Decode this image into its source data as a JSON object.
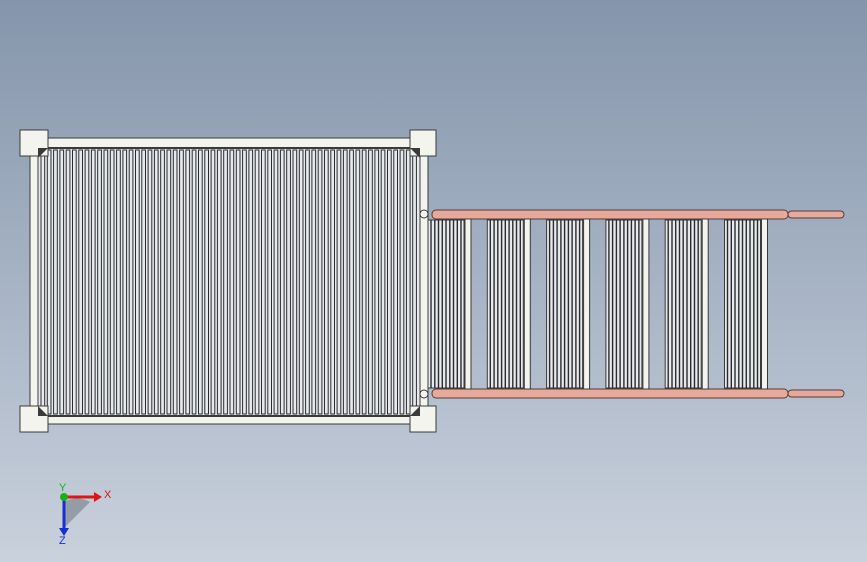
{
  "viewport": {
    "background_top": "#8595ab",
    "background_bottom": "#c9d1dc"
  },
  "model": {
    "frame_color": "#f4f4ef",
    "frame_outline": "#3a3a3a",
    "fin_color": "#2b2b2b",
    "fin_gap_color": "#e6e9ee",
    "pipe_color": "#e6a99c",
    "pipe_outline": "#5a3a34",
    "large_panel_fin_count": 60,
    "small_panel_count": 6
  },
  "triad": {
    "x_label": "X",
    "y_label": "Y",
    "z_label": "Z",
    "x_color": "#e01414",
    "y_color": "#19b019",
    "z_color": "#1430d0"
  }
}
